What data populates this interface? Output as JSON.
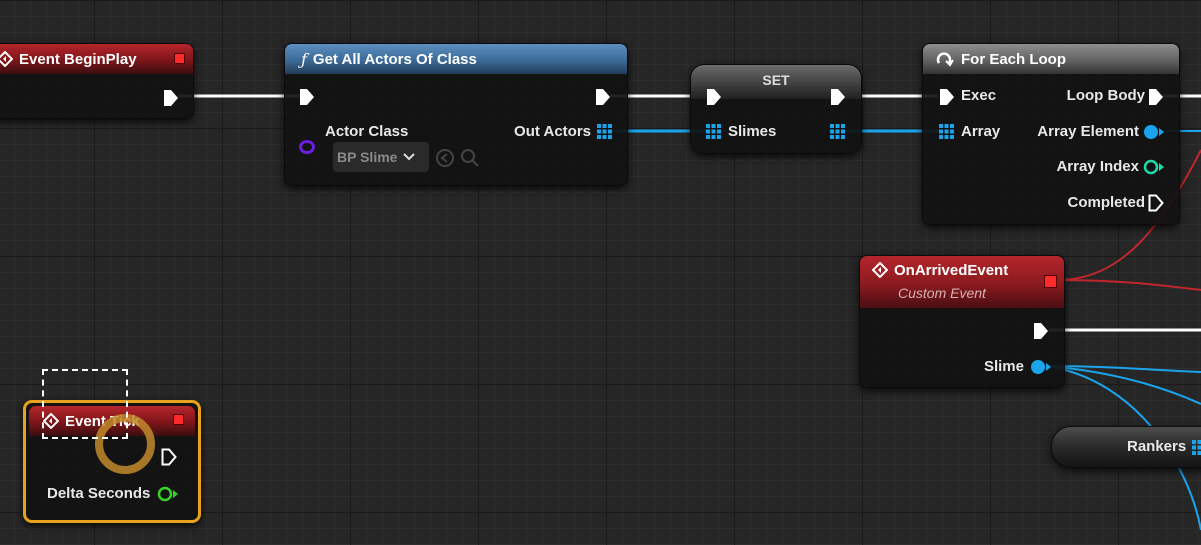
{
  "colors": {
    "exec": "#ffffff",
    "array": "#1aa4ec",
    "object": "#00a7f0",
    "int": "#1ddba9",
    "float": "#37d326",
    "class": "#7a1fff",
    "event_header": "#a11c22",
    "function_header": "#4a7ab0",
    "macro_header": "#7c7c7c",
    "selection": "#e8a21c"
  },
  "nodes": {
    "begin_play": {
      "title": "Event BeginPlay"
    },
    "get_all": {
      "title": "Get All Actors Of Class",
      "actor_class_label": "Actor Class",
      "class_value": "BP Slime",
      "out_actors_label": "Out Actors"
    },
    "set": {
      "title": "SET",
      "pin_label": "Slimes"
    },
    "foreach": {
      "title": "For Each Loop",
      "exec_label": "Exec",
      "loop_body_label": "Loop Body",
      "array_label": "Array",
      "array_element_label": "Array Element",
      "array_index_label": "Array Index",
      "completed_label": "Completed"
    },
    "arrived": {
      "title": "OnArrivedEvent",
      "subtitle": "Custom Event",
      "slime_label": "Slime"
    },
    "rankers": {
      "pin_label": "Rankers"
    },
    "tick": {
      "title": "Event Tick",
      "delta_label": "Delta Seconds"
    }
  },
  "icons": {
    "event": "event-diamond-icon",
    "function": "function-f-icon",
    "loop": "loop-icon",
    "dropdown": "chevron-down-icon",
    "use": "use-selected-arrow-icon",
    "browse": "browse-magnifier-icon"
  }
}
